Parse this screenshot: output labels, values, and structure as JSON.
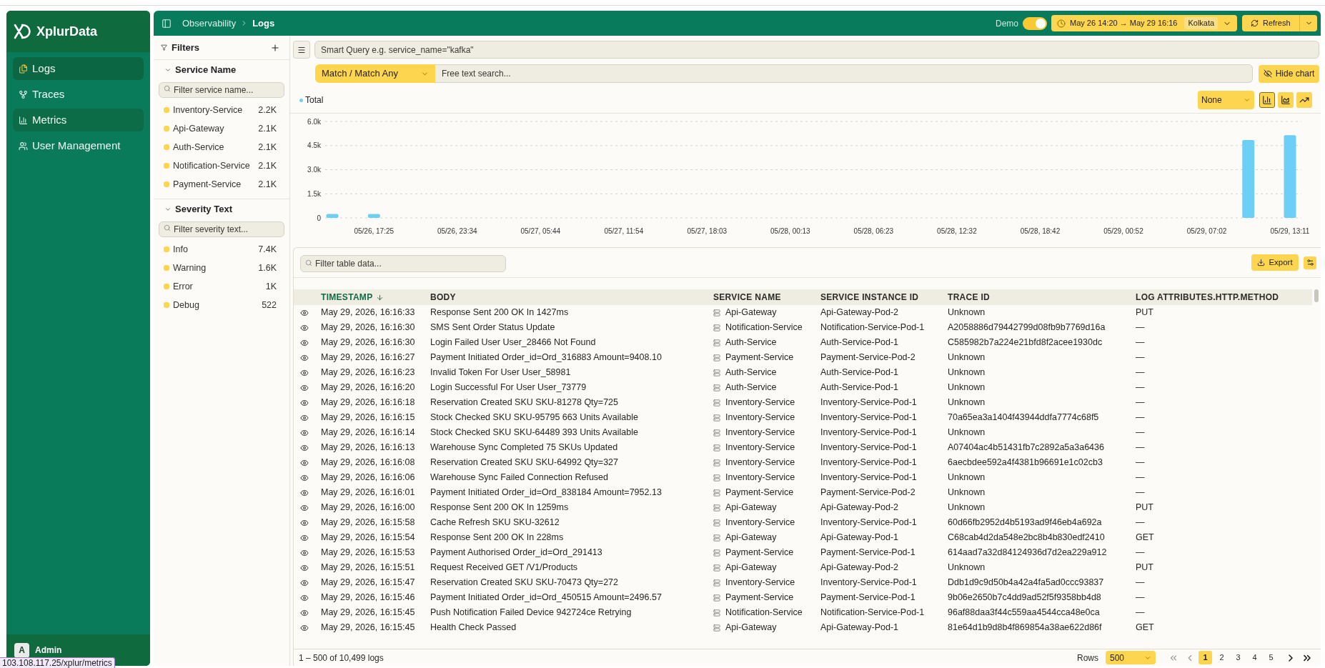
{
  "sidebar": {
    "app_name": "XplurData",
    "items": [
      {
        "label": "Logs",
        "selected": true,
        "hovered": false
      },
      {
        "label": "Traces",
        "selected": false,
        "hovered": false
      },
      {
        "label": "Metrics",
        "selected": false,
        "hovered": true
      },
      {
        "label": "User Management",
        "selected": false,
        "hovered": false
      }
    ],
    "user": {
      "initial": "A",
      "name": "Admin"
    }
  },
  "header": {
    "breadcrumb": [
      "Observability",
      "Logs"
    ],
    "demo": {
      "label": "Demo",
      "on": true
    },
    "time_range": {
      "range": "May 26 14:20 → May 29 16:16",
      "timezone": "Kolkata"
    },
    "refresh": "Refresh"
  },
  "filters": {
    "title": "Filters",
    "sections": [
      {
        "title": "Service Name",
        "expanded": true,
        "placeholder": "Filter service name...",
        "items": [
          {
            "label": "Inventory-Service",
            "count": "2.2K"
          },
          {
            "label": "Api-Gateway",
            "count": "2.1K"
          },
          {
            "label": "Auth-Service",
            "count": "2.1K"
          },
          {
            "label": "Notification-Service",
            "count": "2.1K"
          },
          {
            "label": "Payment-Service",
            "count": "2.1K"
          }
        ]
      },
      {
        "title": "Severity Text",
        "expanded": true,
        "placeholder": "Filter severity text...",
        "items": [
          {
            "label": "Info",
            "count": "7.4K"
          },
          {
            "label": "Warning",
            "count": "1.6K"
          },
          {
            "label": "Error",
            "count": "1K"
          },
          {
            "label": "Debug",
            "count": "522"
          }
        ]
      }
    ]
  },
  "query": {
    "placeholder": "Smart Query e.g. service_name=\"kafka\"",
    "match_mode": "Match / Match Any",
    "free_text_placeholder": "Free text search...",
    "hide_chart": "Hide chart"
  },
  "chart": {
    "group_by": "None",
    "chart_types": [
      {
        "selected": true
      },
      {
        "selected": false
      },
      {
        "selected": false
      }
    ],
    "chart_data": {
      "type": "bar",
      "categories": [
        null,
        "05/26, 17:25",
        null,
        "05/26, 23:34",
        null,
        "05/27, 05:44",
        null,
        "05/27, 11:54",
        null,
        "05/27, 18:03",
        null,
        "05/28, 00:13",
        null,
        "05/28, 06:23",
        null,
        "05/28, 12:32",
        null,
        "05/28, 18:42",
        null,
        "05/29, 00:52",
        null,
        "05/29, 07:02",
        null,
        "05/29, 13:11"
      ],
      "series": [
        {
          "name": "Total",
          "color": "#6ecff6",
          "values": [
            250,
            250,
            0,
            0,
            0,
            0,
            0,
            0,
            0,
            0,
            0,
            0,
            0,
            0,
            0,
            0,
            0,
            0,
            0,
            0,
            0,
            0,
            4850,
            5150
          ]
        }
      ],
      "ylim": [
        0,
        6000
      ],
      "yticks": [
        {
          "value": 0,
          "label": "0"
        },
        {
          "value": 1500,
          "label": "1.5k"
        },
        {
          "value": 3000,
          "label": "3.0k"
        },
        {
          "value": 4500,
          "label": "4.5k"
        },
        {
          "value": 6000,
          "label": "6.0k"
        }
      ],
      "grid": true
    }
  },
  "table": {
    "filter_placeholder": "Filter table data...",
    "export": "Export",
    "columns": [
      {
        "label": "TIMESTAMP",
        "sorted": true
      },
      {
        "label": "BODY",
        "sorted": false
      },
      {
        "label": "SERVICE NAME",
        "sorted": false
      },
      {
        "label": "SERVICE INSTANCE ID",
        "sorted": false
      },
      {
        "label": "TRACE ID",
        "sorted": false
      },
      {
        "label": "LOG ATTRIBUTES.HTTP.METHOD",
        "sorted": false
      }
    ],
    "rows": [
      {
        "cells": [
          "May 29, 2026, 16:16:33",
          "Response Sent 200 OK In 1427ms",
          "Api-Gateway",
          "Api-Gateway-Pod-2",
          "Unknown",
          "PUT"
        ]
      },
      {
        "cells": [
          "May 29, 2026, 16:16:30",
          "SMS Sent Order Status Update",
          "Notification-Service",
          "Notification-Service-Pod-1",
          "A2058886d79442799d08fb9b7769d16a",
          "—"
        ]
      },
      {
        "cells": [
          "May 29, 2026, 16:16:30",
          "Login Failed User User_28466 Not Found",
          "Auth-Service",
          "Auth-Service-Pod-1",
          "C585982b7a224e21bfd8f2acee1930dc",
          "—"
        ]
      },
      {
        "cells": [
          "May 29, 2026, 16:16:27",
          "Payment Initiated Order_id=Ord_316883 Amount=9408.10",
          "Payment-Service",
          "Payment-Service-Pod-2",
          "Unknown",
          "—"
        ]
      },
      {
        "cells": [
          "May 29, 2026, 16:16:23",
          "Invalid Token For User User_58981",
          "Auth-Service",
          "Auth-Service-Pod-1",
          "Unknown",
          "—"
        ]
      },
      {
        "cells": [
          "May 29, 2026, 16:16:20",
          "Login Successful For User User_73779",
          "Auth-Service",
          "Auth-Service-Pod-1",
          "Unknown",
          "—"
        ]
      },
      {
        "cells": [
          "May 29, 2026, 16:16:18",
          "Reservation Created SKU SKU-81278 Qty=725",
          "Inventory-Service",
          "Inventory-Service-Pod-1",
          "Unknown",
          "—"
        ]
      },
      {
        "cells": [
          "May 29, 2026, 16:16:15",
          "Stock Checked SKU SKU-95795 663 Units Available",
          "Inventory-Service",
          "Inventory-Service-Pod-1",
          "70a65ea3a1404f43944ddfa7774c68f5",
          "—"
        ]
      },
      {
        "cells": [
          "May 29, 2026, 16:16:14",
          "Stock Checked SKU SKU-64489 393 Units Available",
          "Inventory-Service",
          "Inventory-Service-Pod-1",
          "Unknown",
          "—"
        ]
      },
      {
        "cells": [
          "May 29, 2026, 16:16:13",
          "Warehouse Sync Completed 75 SKUs Updated",
          "Inventory-Service",
          "Inventory-Service-Pod-1",
          "A07404ac4b51431fb7c2892a5a3a6436",
          "—"
        ]
      },
      {
        "cells": [
          "May 29, 2026, 16:16:08",
          "Reservation Created SKU SKU-64992 Qty=327",
          "Inventory-Service",
          "Inventory-Service-Pod-1",
          "6aecbdee592a4f4381b96691e1c02cb3",
          "—"
        ]
      },
      {
        "cells": [
          "May 29, 2026, 16:16:06",
          "Warehouse Sync Failed Connection Refused",
          "Inventory-Service",
          "Inventory-Service-Pod-1",
          "Unknown",
          "—"
        ]
      },
      {
        "cells": [
          "May 29, 2026, 16:16:01",
          "Payment Initiated Order_id=Ord_838184 Amount=7952.13",
          "Payment-Service",
          "Payment-Service-Pod-2",
          "Unknown",
          "—"
        ]
      },
      {
        "cells": [
          "May 29, 2026, 16:16:00",
          "Response Sent 200 OK In 1259ms",
          "Api-Gateway",
          "Api-Gateway-Pod-2",
          "Unknown",
          "PUT"
        ]
      },
      {
        "cells": [
          "May 29, 2026, 16:15:58",
          "Cache Refresh SKU SKU-32612",
          "Inventory-Service",
          "Inventory-Service-Pod-1",
          "60d66fb2952d4b5193ad9f46eb4a692a",
          "—"
        ]
      },
      {
        "cells": [
          "May 29, 2026, 16:15:54",
          "Response Sent 200 OK In 228ms",
          "Api-Gateway",
          "Api-Gateway-Pod-1",
          "C68cab4d2da548e2bc8b4b830edf2410",
          "GET"
        ]
      },
      {
        "cells": [
          "May 29, 2026, 16:15:53",
          "Payment Authorised Order_id=Ord_291413",
          "Payment-Service",
          "Payment-Service-Pod-1",
          "614aad7a32d84124936d7d2ea229a912",
          "—"
        ]
      },
      {
        "cells": [
          "May 29, 2026, 16:15:51",
          "Request Received GET /V1/Products",
          "Api-Gateway",
          "Api-Gateway-Pod-2",
          "Unknown",
          "PUT"
        ]
      },
      {
        "cells": [
          "May 29, 2026, 16:15:47",
          "Reservation Created SKU SKU-70473 Qty=272",
          "Inventory-Service",
          "Inventory-Service-Pod-1",
          "Ddb1d9c9d50b4a42a4fa5ad0ccc93837",
          "—"
        ]
      },
      {
        "cells": [
          "May 29, 2026, 16:15:46",
          "Payment Initiated Order_id=Ord_450515 Amount=2496.57",
          "Payment-Service",
          "Payment-Service-Pod-1",
          "9b06e2650b7c4dd9ad52f5f9358bb4d8",
          "—"
        ]
      },
      {
        "cells": [
          "May 29, 2026, 16:15:45",
          "Push Notification Failed Device 942724ce Retrying",
          "Notification-Service",
          "Notification-Service-Pod-1",
          "96af88daa3f44c559aa4544cca48e0ca",
          "—"
        ]
      },
      {
        "cells": [
          "May 29, 2026, 16:15:45",
          "Health Check Passed",
          "Api-Gateway",
          "Api-Gateway-Pod-1",
          "81e64d1b9d8b4f869854a38ae622d86f",
          "GET"
        ]
      }
    ]
  },
  "footer": {
    "summary": "1 – 500 of 10,499 logs",
    "rows_label": "Rows",
    "rows_per_page": "500",
    "prev_disabled": true,
    "next_disabled": false,
    "pages": [
      {
        "label": "1",
        "selected": true
      },
      {
        "label": "2",
        "selected": false
      },
      {
        "label": "3",
        "selected": false
      },
      {
        "label": "4",
        "selected": false
      },
      {
        "label": "5",
        "selected": false
      }
    ]
  },
  "status_url": "103.108.117.25/xplur/metrics"
}
